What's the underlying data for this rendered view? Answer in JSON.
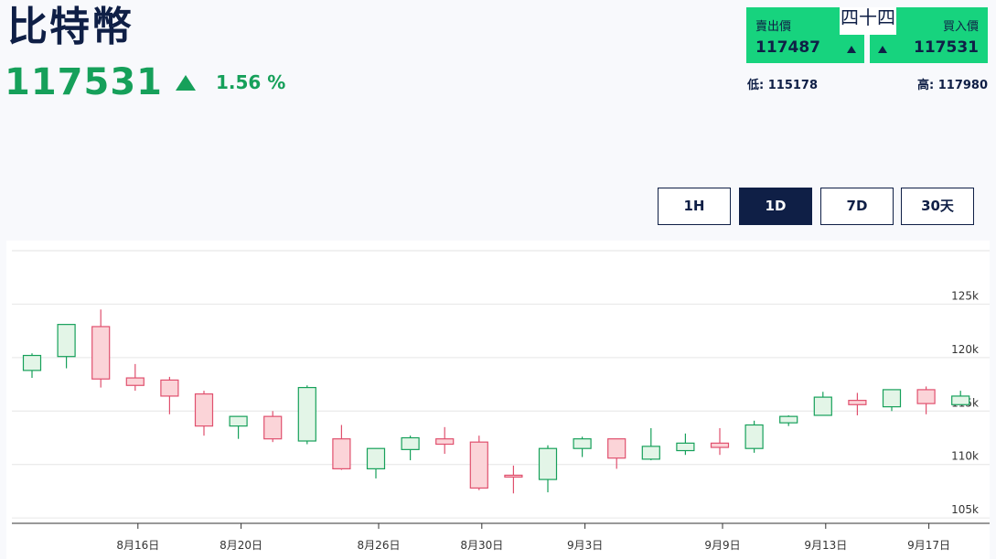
{
  "header": {
    "title": "比特幣",
    "price": "117531",
    "change": "1.56 %"
  },
  "quote": {
    "sell_label": "賣出價",
    "sell_value": "117487",
    "buy_label": "買入價",
    "buy_value": "117531",
    "spread": "四十四",
    "low": "低: 115178",
    "high": "高: 117980"
  },
  "tabs": [
    "1H",
    "1D",
    "7D",
    "30天"
  ],
  "active_tab": "1D",
  "colors": {
    "up": "#16a05a",
    "down": "#e0506e",
    "up_fill": "#e3f5e7",
    "down_fill": "#fbd4d8",
    "navy": "#0f1f46",
    "accent": "#17d37e"
  },
  "chart_data": {
    "type": "candlestick",
    "yticks": [
      "105k",
      "110k",
      "115k",
      "120k",
      "125k"
    ],
    "ytick_values": [
      105,
      110,
      115,
      120,
      125
    ],
    "ylim": [
      104.5,
      130
    ],
    "xtick_labels": [
      "8月16日",
      "8月20日",
      "8月26日",
      "8月30日",
      "9月3日",
      "9月9日",
      "9月13日",
      "9月17日"
    ],
    "xtick_index": [
      3,
      6,
      10,
      13,
      16,
      20,
      23,
      26
    ],
    "candles": [
      {
        "o": 118.8,
        "c": 120.2,
        "h": 120.4,
        "l": 118.1
      },
      {
        "o": 120.1,
        "c": 123.1,
        "h": 123.1,
        "l": 119.0
      },
      {
        "o": 122.9,
        "c": 118.0,
        "h": 124.5,
        "l": 117.2
      },
      {
        "o": 118.1,
        "c": 117.4,
        "h": 119.4,
        "l": 116.9
      },
      {
        "o": 117.9,
        "c": 116.4,
        "h": 118.2,
        "l": 114.7
      },
      {
        "o": 116.6,
        "c": 113.6,
        "h": 116.9,
        "l": 112.7
      },
      {
        "o": 113.6,
        "c": 114.5,
        "h": 114.5,
        "l": 112.4
      },
      {
        "o": 114.5,
        "c": 112.4,
        "h": 115.0,
        "l": 112.1
      },
      {
        "o": 112.2,
        "c": 117.2,
        "h": 117.4,
        "l": 111.9
      },
      {
        "o": 112.4,
        "c": 109.6,
        "h": 113.7,
        "l": 109.5
      },
      {
        "o": 109.6,
        "c": 111.5,
        "h": 111.5,
        "l": 108.7
      },
      {
        "o": 111.4,
        "c": 112.5,
        "h": 112.7,
        "l": 110.4
      },
      {
        "o": 112.4,
        "c": 111.9,
        "h": 113.5,
        "l": 111.0
      },
      {
        "o": 112.1,
        "c": 107.8,
        "h": 112.7,
        "l": 107.6
      },
      {
        "o": 109.0,
        "c": 108.9,
        "h": 109.9,
        "l": 107.3
      },
      {
        "o": 108.6,
        "c": 111.5,
        "h": 111.8,
        "l": 107.4
      },
      {
        "o": 111.5,
        "c": 112.4,
        "h": 112.6,
        "l": 110.7
      },
      {
        "o": 112.4,
        "c": 110.6,
        "h": 112.4,
        "l": 109.6
      },
      {
        "o": 110.5,
        "c": 111.7,
        "h": 113.4,
        "l": 110.4
      },
      {
        "o": 111.3,
        "c": 112.0,
        "h": 112.9,
        "l": 110.9
      },
      {
        "o": 112.0,
        "c": 111.6,
        "h": 113.4,
        "l": 110.9
      },
      {
        "o": 111.5,
        "c": 113.7,
        "h": 114.1,
        "l": 111.1
      },
      {
        "o": 113.9,
        "c": 114.5,
        "h": 114.6,
        "l": 113.6
      },
      {
        "o": 114.6,
        "c": 116.3,
        "h": 116.8,
        "l": 114.6
      },
      {
        "o": 116.0,
        "c": 115.6,
        "h": 116.7,
        "l": 114.6
      },
      {
        "o": 115.4,
        "c": 117.0,
        "h": 117.0,
        "l": 115.0
      },
      {
        "o": 117.0,
        "c": 115.7,
        "h": 117.3,
        "l": 114.7
      },
      {
        "o": 115.6,
        "c": 116.4,
        "h": 116.9,
        "l": 115.6
      }
    ]
  }
}
